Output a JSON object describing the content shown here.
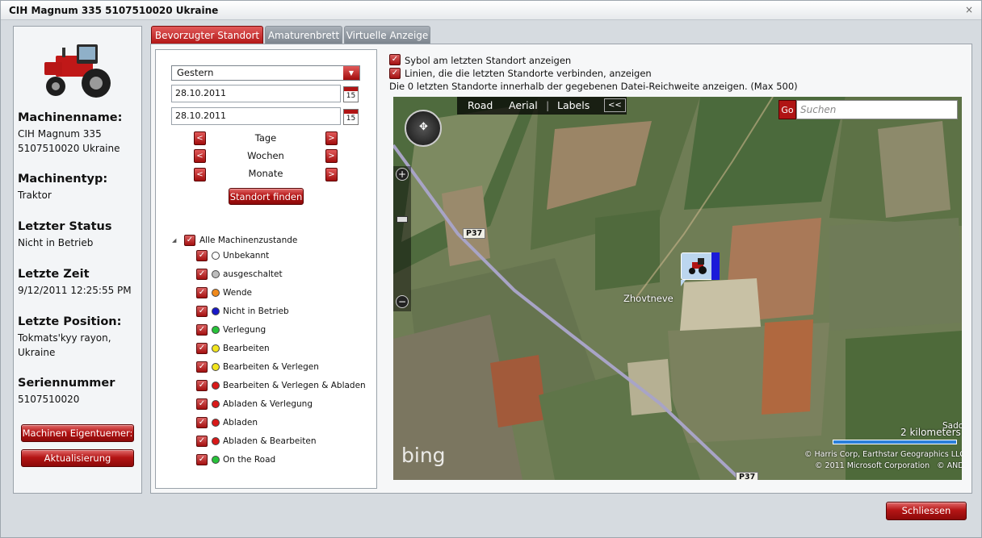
{
  "window": {
    "title": "CIH Magnum 335 5107510020 Ukraine",
    "close_glyph": "×"
  },
  "info": {
    "name_label": "Machinenname:",
    "name_line1": "CIH Magnum 335",
    "name_line2": "5107510020 Ukraine",
    "type_label": "Machinentyp:",
    "type_value": "Traktor",
    "status_label": "Letzter Status",
    "status_value": "Nicht in Betrieb",
    "time_label": "Letzte Zeit",
    "time_value": "9/12/2011 12:25:55 PM",
    "position_label": "Letzte Position:",
    "position_line1": "Tokmats'kyy rayon,",
    "position_line2": "Ukraine",
    "serial_label": "Seriennummer",
    "serial_value": "5107510020",
    "owner_button": "Machinen Eigentuemer:",
    "refresh_button": "Aktualisierung"
  },
  "tabs": [
    {
      "label": "Bevorzugter Standort"
    },
    {
      "label": "Amaturenbrett"
    },
    {
      "label": "Virtuelle Anzeige"
    }
  ],
  "filter": {
    "period_value": "Gestern",
    "date_from": "28.10.2011",
    "date_to": "28.10.2011",
    "calendar_glyph": "15",
    "prev_glyph": "<",
    "next_glyph": ">",
    "days_label": "Tage",
    "weeks_label": "Wochen",
    "months_label": "Monate",
    "find_button": "Standort finden"
  },
  "tree": {
    "root_label": "Alle Machinenzustande",
    "expand_glyph": "◢",
    "items": [
      {
        "label": "Unbekannt",
        "color": "#ffffff"
      },
      {
        "label": "ausgeschaltet",
        "color": "#bdbdbd"
      },
      {
        "label": "Wende",
        "color": "#f08a1c"
      },
      {
        "label": "Nicht in Betrieb",
        "color": "#1818c8"
      },
      {
        "label": "Verlegung",
        "color": "#27c23a"
      },
      {
        "label": "Bearbeiten",
        "color": "#f2e51e"
      },
      {
        "label": "Bearbeiten & Verlegen",
        "color": "#f2e51e"
      },
      {
        "label": "Bearbeiten & Verlegen & Abladen",
        "color": "#d81919"
      },
      {
        "label": "Abladen & Verlegung",
        "color": "#d81919"
      },
      {
        "label": "Abladen",
        "color": "#d81919"
      },
      {
        "label": "Abladen & Bearbeiten",
        "color": "#d81919"
      },
      {
        "label": "On the Road",
        "color": "#27c23a"
      }
    ]
  },
  "map_options": {
    "symbol_label": "Sybol am letzten Standort anzeigen",
    "lines_label": "Linien, die die letzten Standorte verbinden, anzeigen",
    "info_text": "Die 0 letzten Standorte innerhalb der gegebenen Datei-Reichweite anzeigen. (Max 500)"
  },
  "map": {
    "road_label": "Road",
    "aerial_label": "Aerial",
    "labels_label": "Labels",
    "collapse_glyph": "<<",
    "search_placeholder": "Suchen",
    "go_label": "Go",
    "road_code_1": "P37",
    "road_code_2": "P37",
    "place_name": "Zhovtneve",
    "place_edge": "Sado",
    "scale_label": "2 kilometers",
    "brand": "bing",
    "copyright_1": "© Harris Corp, Earthstar Geographics LLC",
    "copyright_2": "© 2011 Microsoft Corporation   © AND",
    "zoom_in_glyph": "+",
    "zoom_out_glyph": "−"
  },
  "footer": {
    "close_button": "Schliessen"
  },
  "colors": {
    "accent_red": "#b01414",
    "panel_bg": "#f3f5f7"
  }
}
